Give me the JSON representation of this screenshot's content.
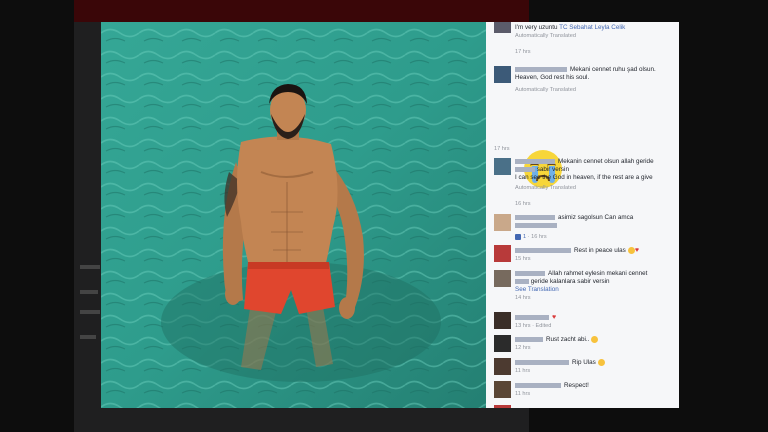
{
  "comments": [
    {
      "text": "I'm very uzuntu",
      "tag": "TC Sebahat Leyla Celik",
      "translated": "Automatically Translated",
      "time": "17 hrs"
    },
    {
      "text": "Mekani cennet ruhu şad olsun.",
      "translation": "Heaven, God rest his soul.",
      "translated": "Automatically Translated",
      "time": "17 hrs"
    },
    {
      "text": "Mekanin cennet olsun allah geride",
      "text2": "sabir versin",
      "translation": "I can see the God in heaven, if the rest are a give",
      "translated": "Automatically Translated",
      "time": "16 hrs"
    },
    {
      "text": "asimiz sagolsun Can amca",
      "likes": "1",
      "time": "16 hrs"
    },
    {
      "text": "Rest in peace ulas",
      "time": "15 hrs"
    },
    {
      "text": "Allah rahmet eylesin mekani cennet",
      "text2": "geride kalanlara sabir versin",
      "see_translation": "See Translation",
      "time": "14 hrs"
    },
    {
      "time": "13 hrs",
      "edited": "Edited"
    },
    {
      "text": "Rust zacht abi..",
      "time": "12 hrs"
    },
    {
      "text": "Rip Ulas",
      "time": "11 hrs"
    },
    {
      "text": "Respect!",
      "time": "11 hrs"
    }
  ],
  "colors": {
    "link": "#4267b2",
    "meta": "#90949c",
    "panel_bg": "#f6f7f9",
    "water": "#3aa79a"
  }
}
